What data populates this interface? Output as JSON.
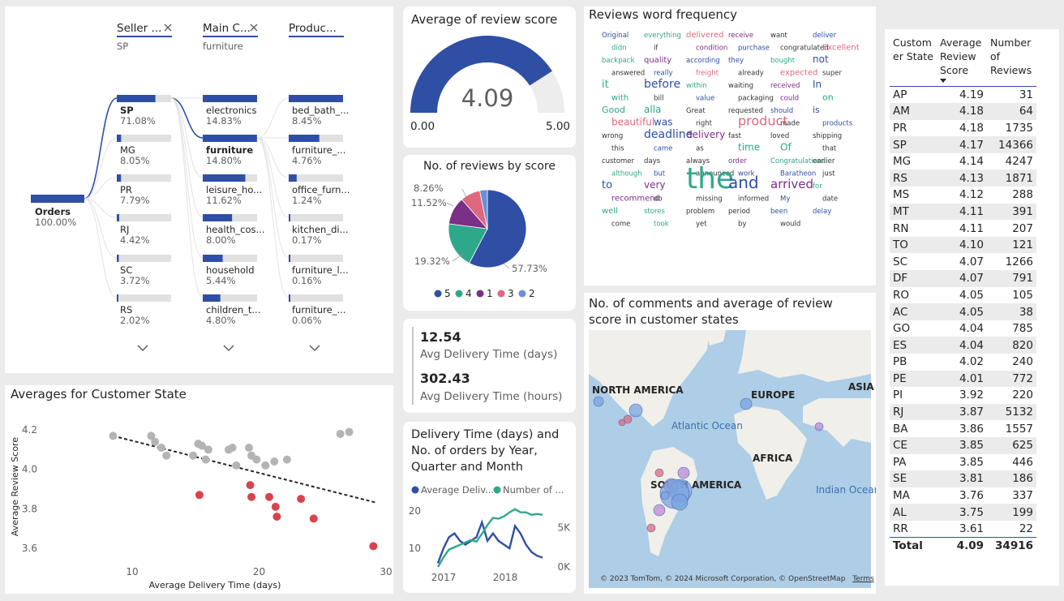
{
  "decomposition": {
    "headers": [
      {
        "label": "Seller ...",
        "filter": "SP"
      },
      {
        "label": "Main C...",
        "filter": "furniture"
      },
      {
        "label": "Produc...",
        "filter": ""
      }
    ],
    "root": {
      "label": "Orders",
      "value": "100.00%"
    },
    "level1": [
      {
        "label": "SP",
        "value": "71.08%",
        "pct": 71.08,
        "bold": true
      },
      {
        "label": "MG",
        "value": "8.05%",
        "pct": 8.05
      },
      {
        "label": "PR",
        "value": "7.79%",
        "pct": 7.79
      },
      {
        "label": "RJ",
        "value": "4.42%",
        "pct": 4.42
      },
      {
        "label": "SC",
        "value": "3.72%",
        "pct": 3.72
      },
      {
        "label": "RS",
        "value": "2.02%",
        "pct": 2.02
      }
    ],
    "level2": [
      {
        "label": "electronics",
        "value": "14.83%",
        "pct": 14.83
      },
      {
        "label": "furniture",
        "value": "14.80%",
        "pct": 14.8,
        "bold": true
      },
      {
        "label": "leisure_ho...",
        "value": "11.62%",
        "pct": 11.62
      },
      {
        "label": "health_cos...",
        "value": "8.00%",
        "pct": 8.0
      },
      {
        "label": "household",
        "value": "5.44%",
        "pct": 5.44
      },
      {
        "label": "children_t...",
        "value": "4.80%",
        "pct": 4.8
      }
    ],
    "level3": [
      {
        "label": "bed_bath_...",
        "value": "8.45%",
        "pct": 8.45
      },
      {
        "label": "furniture_...",
        "value": "4.76%",
        "pct": 4.76
      },
      {
        "label": "office_furn...",
        "value": "1.24%",
        "pct": 1.24
      },
      {
        "label": "kitchen_di...",
        "value": "0.17%",
        "pct": 0.17
      },
      {
        "label": "furniture_l...",
        "value": "0.16%",
        "pct": 0.16
      },
      {
        "label": "furniture_...",
        "value": "0.06%",
        "pct": 0.06
      }
    ]
  },
  "gauge": {
    "title": "Average of review score",
    "value": "4.09",
    "min": "0.00",
    "max": "5.00",
    "fraction": 0.818
  },
  "pie": {
    "title": "No. of reviews by score",
    "slices": [
      {
        "label": "5",
        "pct": 57.73,
        "color": "#2f4fa5"
      },
      {
        "label": "4",
        "pct": 19.32,
        "color": "#2ea88a"
      },
      {
        "label": "1",
        "pct": 11.52,
        "color": "#7b2f86"
      },
      {
        "label": "3",
        "pct": 8.26,
        "color": "#e0687e"
      },
      {
        "label": "2",
        "pct": 3.17,
        "color": "#6a8fd6"
      }
    ],
    "callouts": [
      "8.26%",
      "11.52%",
      "19.32%",
      "57.73%"
    ]
  },
  "kpi": {
    "days_value": "12.54",
    "days_label": "Avg Delivery Time (days)",
    "hours_value": "302.43",
    "hours_label": "Avg Delivery Time (hours)"
  },
  "words": {
    "title": "Reviews word frequency",
    "items": [
      {
        "t": "Original",
        "c": "#2f4fa5"
      },
      {
        "t": "everything",
        "c": "#2ea88a"
      },
      {
        "t": "delivered",
        "c": "#e0687e"
      },
      {
        "t": "receive",
        "c": "#7b2f86"
      },
      {
        "t": "want",
        "c": "#333"
      },
      {
        "t": "deliver",
        "c": "#2f4fa5"
      },
      {
        "t": "didn",
        "c": "#2ea88a"
      },
      {
        "t": "if",
        "c": "#333"
      },
      {
        "t": "condition",
        "c": "#7b2f86"
      },
      {
        "t": "purchase",
        "c": "#2f4fa5"
      },
      {
        "t": "congratulated",
        "c": "#333"
      },
      {
        "t": "Excellent",
        "c": "#e0687e"
      },
      {
        "t": "backpack",
        "c": "#2ea88a"
      },
      {
        "t": "quality",
        "c": "#7b2f86"
      },
      {
        "t": "according",
        "c": "#2f4fa5"
      },
      {
        "t": "they",
        "c": "#2f4fa5"
      },
      {
        "t": "bought",
        "c": "#2ea88a"
      },
      {
        "t": "not",
        "c": "#2f4fa5"
      },
      {
        "t": "answered",
        "c": "#333"
      },
      {
        "t": "really",
        "c": "#2f4fa5"
      },
      {
        "t": "freight",
        "c": "#e0687e"
      },
      {
        "t": "already",
        "c": "#333"
      },
      {
        "t": "expected",
        "c": "#e0687e"
      },
      {
        "t": "super",
        "c": "#333"
      },
      {
        "t": "it",
        "c": "#2ea88a"
      },
      {
        "t": "before",
        "c": "#2f4fa5"
      },
      {
        "t": "within",
        "c": "#2ea88a"
      },
      {
        "t": "waiting",
        "c": "#333"
      },
      {
        "t": "received",
        "c": "#7b2f86"
      },
      {
        "t": "In",
        "c": "#2f4fa5"
      },
      {
        "t": "with",
        "c": "#2ea88a"
      },
      {
        "t": "bill",
        "c": "#333"
      },
      {
        "t": "value",
        "c": "#2f4fa5"
      },
      {
        "t": "packaging",
        "c": "#333"
      },
      {
        "t": "could",
        "c": "#7b2f86"
      },
      {
        "t": "on",
        "c": "#2ea88a"
      },
      {
        "t": "Good",
        "c": "#2ea88a"
      },
      {
        "t": "alla",
        "c": "#2ea88a"
      },
      {
        "t": "Great",
        "c": "#333"
      },
      {
        "t": "requested",
        "c": "#333"
      },
      {
        "t": "should",
        "c": "#2f4fa5"
      },
      {
        "t": "is",
        "c": "#2f4fa5"
      },
      {
        "t": "beautiful",
        "c": "#e0687e"
      },
      {
        "t": "was",
        "c": "#2f4fa5"
      },
      {
        "t": "right",
        "c": "#333"
      },
      {
        "t": "product",
        "c": "#e0687e"
      },
      {
        "t": "made",
        "c": "#333"
      },
      {
        "t": "products",
        "c": "#2f4fa5"
      },
      {
        "t": "wrong",
        "c": "#333"
      },
      {
        "t": "deadline",
        "c": "#2f4fa5"
      },
      {
        "t": "delivery",
        "c": "#7b2f86"
      },
      {
        "t": "fast",
        "c": "#333"
      },
      {
        "t": "loved",
        "c": "#333"
      },
      {
        "t": "shipping",
        "c": "#333"
      },
      {
        "t": "this",
        "c": "#333"
      },
      {
        "t": "came",
        "c": "#2f4fa5"
      },
      {
        "t": "as",
        "c": "#333"
      },
      {
        "t": "time",
        "c": "#2ea88a"
      },
      {
        "t": "Of",
        "c": "#2ea88a"
      },
      {
        "t": "that",
        "c": "#333"
      },
      {
        "t": "customer",
        "c": "#333"
      },
      {
        "t": "days",
        "c": "#333"
      },
      {
        "t": "always",
        "c": "#333"
      },
      {
        "t": "order",
        "c": "#7b2f86"
      },
      {
        "t": "Congratulations",
        "c": "#2ea88a"
      },
      {
        "t": "earlier",
        "c": "#333"
      },
      {
        "t": "although",
        "c": "#2ea88a"
      },
      {
        "t": "but",
        "c": "#2f4fa5"
      },
      {
        "t": "announced",
        "c": "#333"
      },
      {
        "t": "work",
        "c": "#2f4fa5"
      },
      {
        "t": "Baratheon",
        "c": "#2f4fa5"
      },
      {
        "t": "just",
        "c": "#333"
      },
      {
        "t": "to",
        "c": "#2f4fa5"
      },
      {
        "t": "very",
        "c": "#7b2f86"
      },
      {
        "t": "the",
        "c": "#2ea88a"
      },
      {
        "t": "and",
        "c": "#2f4fa5"
      },
      {
        "t": "arrived",
        "c": "#7b2f86"
      },
      {
        "t": "for",
        "c": "#2ea88a"
      },
      {
        "t": "recommend",
        "c": "#7b2f86"
      },
      {
        "t": "do",
        "c": "#333"
      },
      {
        "t": "missing",
        "c": "#333"
      },
      {
        "t": "informed",
        "c": "#333"
      },
      {
        "t": "My",
        "c": "#2f4fa5"
      },
      {
        "t": "date",
        "c": "#333"
      },
      {
        "t": "well",
        "c": "#2ea88a"
      },
      {
        "t": "stores",
        "c": "#2ea88a"
      },
      {
        "t": "problem",
        "c": "#333"
      },
      {
        "t": "period",
        "c": "#333"
      },
      {
        "t": "been",
        "c": "#2f4fa5"
      },
      {
        "t": "delay",
        "c": "#2f4fa5"
      },
      {
        "t": "come",
        "c": "#333"
      },
      {
        "t": "took",
        "c": "#2ea88a"
      },
      {
        "t": "yet",
        "c": "#333"
      },
      {
        "t": "by",
        "c": "#333"
      },
      {
        "t": "would",
        "c": "#333"
      }
    ]
  },
  "map": {
    "title": "No. of comments and average of review score in customer states",
    "labels": {
      "na": "NORTH AMERICA",
      "eu": "EUROPE",
      "as": "ASIA",
      "af": "AFRICA",
      "sa": "SOUTH AMERICA",
      "ao": "Atlantic Ocean",
      "io": "Indian Ocean"
    },
    "credit": "© 2023 TomTom, © 2024 Microsoft Corporation, © OpenStreetMap",
    "terms": "Terms"
  },
  "scatter": {
    "title": "Averages for Customer State",
    "xlabel": "Average Delivery Time (days)",
    "ylabel": "Average Review Score",
    "xticks": [
      "10",
      "20",
      "30"
    ],
    "yticks": [
      "4.2",
      "4.0",
      "3.8",
      "3.6"
    ]
  },
  "combo": {
    "title": "Delivery Time (days) and No. of orders by Year, Quarter and Month",
    "legend": [
      "Average Deliv...",
      "Number of ..."
    ],
    "legend_colors": [
      "#2f4fa5",
      "#2ea88a"
    ],
    "left_ticks": [
      "20",
      "10"
    ],
    "right_ticks": [
      "5K",
      "0K"
    ],
    "xticks": [
      "2017",
      "2018"
    ]
  },
  "table": {
    "headers": [
      "Custom er State",
      "Average Review Score",
      "Number of Reviews"
    ],
    "rows": [
      [
        "AP",
        "4.19",
        "31"
      ],
      [
        "AM",
        "4.18",
        "64"
      ],
      [
        "PR",
        "4.18",
        "1735"
      ],
      [
        "SP",
        "4.17",
        "14366"
      ],
      [
        "MG",
        "4.14",
        "4247"
      ],
      [
        "RS",
        "4.13",
        "1871"
      ],
      [
        "MS",
        "4.12",
        "288"
      ],
      [
        "MT",
        "4.11",
        "391"
      ],
      [
        "RN",
        "4.11",
        "207"
      ],
      [
        "TO",
        "4.10",
        "121"
      ],
      [
        "SC",
        "4.07",
        "1266"
      ],
      [
        "DF",
        "4.07",
        "791"
      ],
      [
        "RO",
        "4.05",
        "105"
      ],
      [
        "AC",
        "4.05",
        "38"
      ],
      [
        "GO",
        "4.04",
        "785"
      ],
      [
        "ES",
        "4.04",
        "820"
      ],
      [
        "PB",
        "4.02",
        "240"
      ],
      [
        "PE",
        "4.01",
        "772"
      ],
      [
        "PI",
        "3.92",
        "220"
      ],
      [
        "RJ",
        "3.87",
        "5132"
      ],
      [
        "BA",
        "3.86",
        "1557"
      ],
      [
        "CE",
        "3.85",
        "625"
      ],
      [
        "PA",
        "3.85",
        "446"
      ],
      [
        "SE",
        "3.81",
        "186"
      ],
      [
        "MA",
        "3.76",
        "337"
      ],
      [
        "AL",
        "3.75",
        "199"
      ],
      [
        "RR",
        "3.61",
        "22"
      ]
    ],
    "total": [
      "Total",
      "4.09",
      "34916"
    ]
  },
  "chart_data": [
    {
      "type": "scatter",
      "title": "Averages for Customer State",
      "xlabel": "Average Delivery Time (days)",
      "ylabel": "Average Review Score",
      "xlim": [
        7,
        30
      ],
      "ylim": [
        3.55,
        4.25
      ],
      "series": [
        {
          "name": "",
          "color": "#b4b4b4",
          "points": [
            [
              8.5,
              4.17
            ],
            [
              11.5,
              4.17
            ],
            [
              11.8,
              4.14
            ],
            [
              12.3,
              4.11
            ],
            [
              12.7,
              4.07
            ],
            [
              14.8,
              4.07
            ],
            [
              15.2,
              4.13
            ],
            [
              15.5,
              4.12
            ],
            [
              15.8,
              4.05
            ],
            [
              16.0,
              4.1
            ],
            [
              17.6,
              4.1
            ],
            [
              17.9,
              4.11
            ],
            [
              18.2,
              4.02
            ],
            [
              19.2,
              4.11
            ],
            [
              19.4,
              4.07
            ],
            [
              19.8,
              4.05
            ],
            [
              20.5,
              4.02
            ],
            [
              21.2,
              4.04
            ],
            [
              22.2,
              4.05
            ],
            [
              26.4,
              4.18
            ],
            [
              27.1,
              4.19
            ]
          ]
        },
        {
          "name": "",
          "color": "#d9434e",
          "points": [
            [
              15.3,
              3.87
            ],
            [
              19.3,
              3.92
            ],
            [
              19.4,
              3.86
            ],
            [
              20.8,
              3.86
            ],
            [
              21.3,
              3.81
            ],
            [
              21.4,
              3.76
            ],
            [
              23.3,
              3.85
            ],
            [
              24.3,
              3.75
            ],
            [
              29.0,
              3.61
            ]
          ]
        }
      ],
      "trend": [
        [
          8.5,
          4.17
        ],
        [
          29.3,
          3.83
        ]
      ]
    },
    {
      "type": "line",
      "title": "Delivery Time (days) and No. of orders by Year, Quarter and Month",
      "xticks": [
        "2017",
        "2018"
      ],
      "left_ylim": [
        5,
        22
      ],
      "right_ylim": [
        0,
        8000
      ],
      "series": [
        {
          "name": "Average Delivery Time (days)",
          "axis": "left",
          "color": "#2f4fa5",
          "values": [
            6,
            10,
            13,
            14,
            12,
            11,
            12,
            13,
            17,
            12,
            14,
            12,
            11,
            10,
            16,
            14,
            11,
            9,
            8,
            7.5
          ]
        },
        {
          "name": "Number of orders",
          "axis": "right",
          "color": "#2ea88a",
          "values": [
            0,
            1200,
            2200,
            2500,
            2800,
            3100,
            3400,
            3200,
            4200,
            5300,
            6200,
            6100,
            6400,
            6900,
            7300,
            6900,
            6900,
            6600,
            6700,
            6600
          ]
        }
      ]
    },
    {
      "type": "pie",
      "title": "No. of reviews by score",
      "categories": [
        "5",
        "4",
        "1",
        "3",
        "2"
      ],
      "values": [
        57.73,
        19.32,
        11.52,
        8.26,
        3.17
      ]
    }
  ]
}
